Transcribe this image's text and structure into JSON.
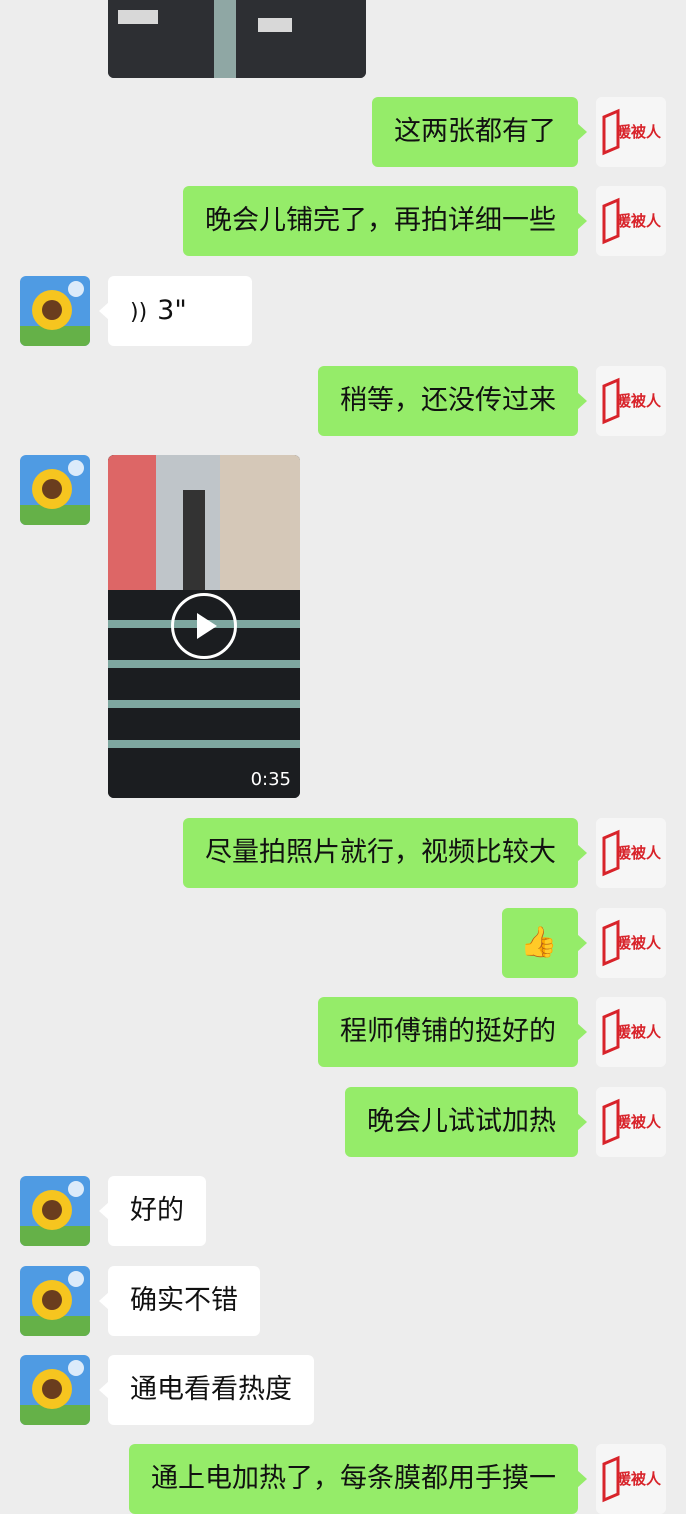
{
  "brand_logo_text": "暖被人",
  "messages": [
    {
      "type": "text",
      "side": "out",
      "text": "这两张都有了"
    },
    {
      "type": "text",
      "side": "out",
      "text": "晚会儿铺完了，再拍详细一些"
    },
    {
      "type": "voice",
      "side": "in",
      "duration": "3\""
    },
    {
      "type": "text",
      "side": "out",
      "text": "稍等，还没传过来"
    },
    {
      "type": "video",
      "side": "in",
      "duration": "0:35"
    },
    {
      "type": "text",
      "side": "out",
      "text": "尽量拍照片就行，视频比较大"
    },
    {
      "type": "emoji",
      "side": "out",
      "icon": "thumbs-up-icon"
    },
    {
      "type": "text",
      "side": "out",
      "text": "程师傅铺的挺好的"
    },
    {
      "type": "text",
      "side": "out",
      "text": "晚会儿试试加热"
    },
    {
      "type": "text",
      "side": "in",
      "text": "好的"
    },
    {
      "type": "text",
      "side": "in",
      "text": "确实不错"
    },
    {
      "type": "text",
      "side": "in",
      "text": "通电看看热度"
    },
    {
      "type": "text",
      "side": "out",
      "text": "通上电加热了，每条膜都用手摸一"
    }
  ]
}
